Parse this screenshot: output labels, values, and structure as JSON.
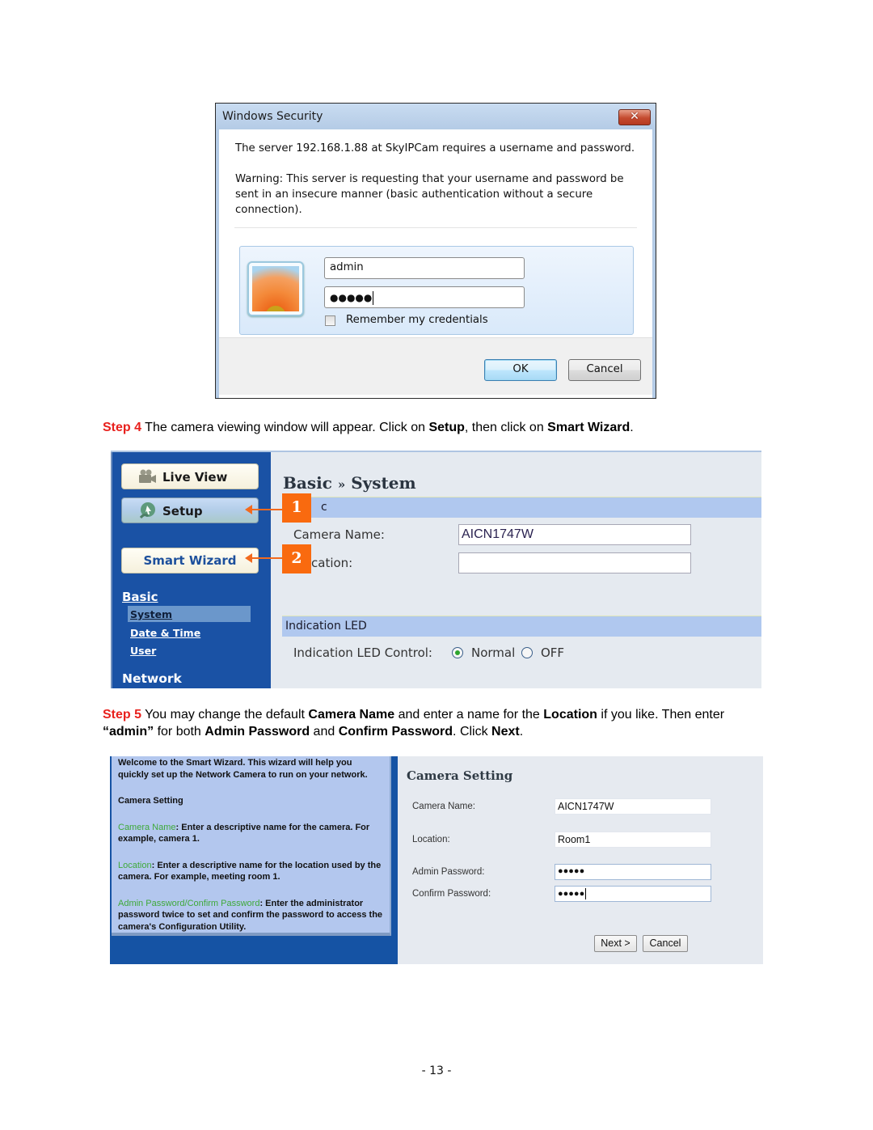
{
  "dialog": {
    "title": "Windows Security",
    "close_glyph": "✕",
    "message": "The server 192.168.1.88 at SkyIPCam requires a username and password.",
    "warning_lines": [
      "Warning: This server is requesting that your username and password be",
      "sent in an insecure manner (basic authentication without a secure",
      "connection)."
    ],
    "username_value": "admin",
    "password_mask": "●●●●●",
    "remember_label": "Remember my credentials",
    "remember_checked": false,
    "ok_label": "OK",
    "cancel_label": "Cancel"
  },
  "step4": {
    "label": "Step 4",
    "text_1": " The camera viewing window will appear.  Click on ",
    "bold_1": "Setup",
    "text_2": ", then click on ",
    "bold_2": "Smart Wizard",
    "text_3": "."
  },
  "camera_ui": {
    "nav": {
      "live_view": "Live View",
      "setup": "Setup",
      "smart_wizard": "Smart Wizard",
      "section_basic": "Basic",
      "sub_items": [
        "System",
        "Date & Time",
        "User"
      ],
      "selected_sub_item": "System",
      "section_network": "Network"
    },
    "page_title_part1": "Basic",
    "page_title_sep": "»",
    "page_title_part2": "System",
    "band1_text": "c",
    "camera_name_label": "Camera Name:",
    "camera_name_value": "AICN1747W",
    "location_label": "cation:",
    "location_value": "",
    "band2_text": "Indication LED",
    "led_label": "Indication LED Control:",
    "led_options": [
      "Normal",
      "OFF"
    ],
    "led_selected": "Normal",
    "callouts": [
      "1",
      "2"
    ],
    "accent_color": "#f96a0f"
  },
  "step5": {
    "label": "Step 5",
    "t1": " You may change the default ",
    "b1": "Camera Name",
    "t2": " and enter a name for the ",
    "b2": "Location",
    "t3": " if you like.  Then enter ",
    "b3": "“admin”",
    "t4": " for both ",
    "b4": "Admin Password",
    "t5": " and ",
    "b5": "Confirm Password",
    "t6": ".  Click ",
    "b6": "Next",
    "t7": "."
  },
  "wizard": {
    "intro": "Welcome to the Smart Wizard. This wizard will help you quickly set up the Network Camera to run on your network.",
    "section": "Camera Setting",
    "help": [
      {
        "term": "Camera Name",
        "desc": ": Enter a descriptive name for the camera. For example, camera 1."
      },
      {
        "term": "Location",
        "desc": ": Enter a descriptive name for the location used by the camera. For example, meeting room 1."
      },
      {
        "term": "Admin Password/Confirm Password",
        "desc": ": Enter the administrator password twice to set and confirm the password to access the camera's Configuration Utility."
      }
    ],
    "title": "Camera Setting",
    "fields": [
      {
        "label": "Camera Name:",
        "value": "AICN1747W"
      },
      {
        "label": "Location:",
        "value": "Room1"
      },
      {
        "label": "Admin Password:",
        "value": "●●●●●"
      },
      {
        "label": "Confirm Password:",
        "value": "●●●●●"
      }
    ],
    "next_label": "Next >",
    "cancel_label": "Cancel"
  },
  "page_number": "- 13 -"
}
